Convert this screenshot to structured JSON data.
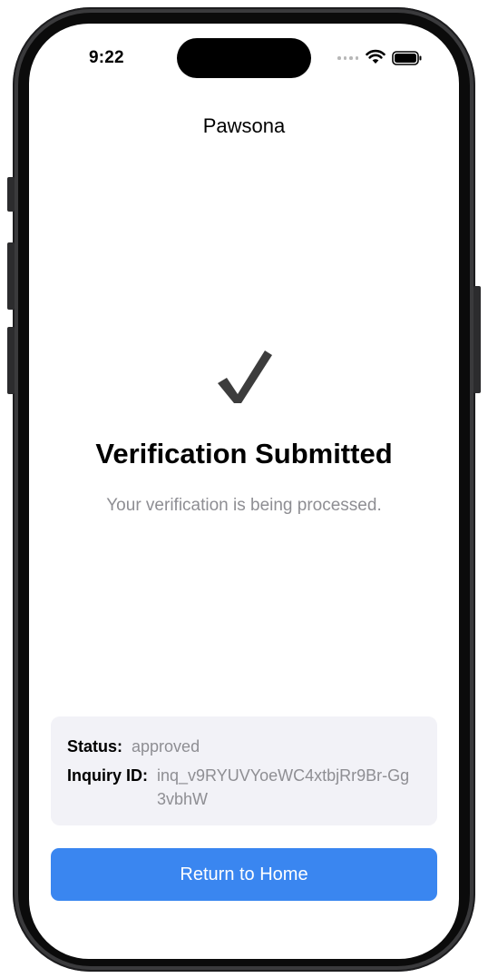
{
  "status_bar": {
    "time": "9:22",
    "icons": [
      "signal-dots-icon",
      "wifi-icon",
      "battery-icon"
    ]
  },
  "app": {
    "title": "Pawsona"
  },
  "result": {
    "icon": "checkmark-icon",
    "heading": "Verification Submitted",
    "subtitle": "Your verification is being processed."
  },
  "details": {
    "status_label": "Status:",
    "status_value": "approved",
    "inquiry_label": "Inquiry ID:",
    "inquiry_value": "inq_v9RYUVYoeWC4xtbjRr9Br-Gg3vbhW"
  },
  "actions": {
    "return_label": "Return to Home"
  },
  "colors": {
    "accent": "#3a86f0",
    "card_background": "#f2f2f7",
    "secondary_text": "#8e8e93",
    "check": "#3c3c3c"
  }
}
